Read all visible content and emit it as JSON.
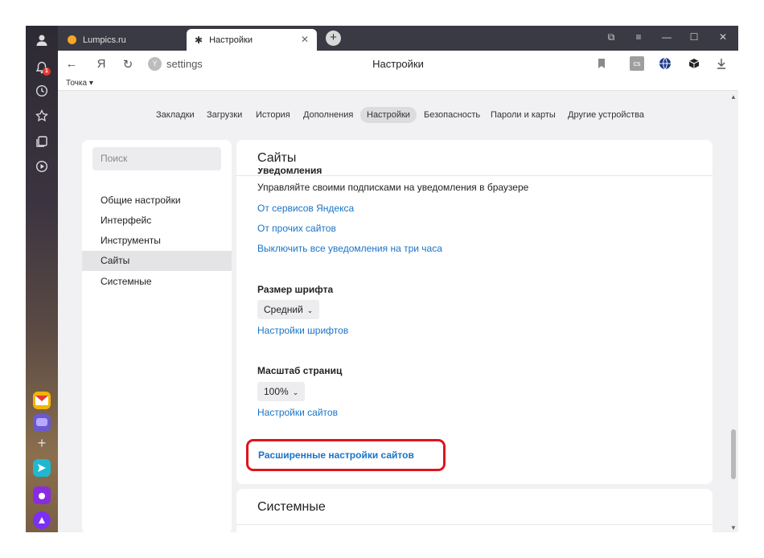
{
  "colors": {
    "accent_link": "#1a73c8",
    "highlight_box": "#e0141c",
    "tab_strip": "#3a3a44",
    "sidebar_dark": "#2d2a33"
  },
  "sidebar_icons": [
    "user-icon",
    "bell-icon",
    "history-icon",
    "star-icon",
    "collections-icon",
    "play-icon"
  ],
  "notification_badge": "1",
  "sidebar_apps": [
    "mail-app-icon",
    "messenger-app-icon",
    "add-icon",
    "send-app-icon",
    "music-app-icon",
    "alice-app-icon"
  ],
  "tabs": [
    {
      "label": "Lumpics.ru",
      "icon": "favicon-dot-icon"
    },
    {
      "label": "Настройки",
      "icon": "gear-icon",
      "close": "✕"
    }
  ],
  "window_controls": [
    "⧉",
    "≡",
    "—",
    "☐",
    "✕"
  ],
  "address_bar": {
    "back": "←",
    "yandex": "Я",
    "reload": "↻",
    "url": "settings",
    "page_title": "Настройки",
    "bookmarks_bar_item": "Точка ▾",
    "extension_lastpass": "cs"
  },
  "nav_tabs": [
    "Закладки",
    "Загрузки",
    "История",
    "Дополнения",
    "Настройки",
    "Безопасность",
    "Пароли и карты",
    "Другие устройства"
  ],
  "nav_active": "Настройки",
  "settings_sidebar": {
    "search_placeholder": "Поиск",
    "items": [
      "Общие настройки",
      "Интерфейс",
      "Инструменты",
      "Сайты",
      "Системные"
    ],
    "active": "Сайты"
  },
  "sites_card": {
    "title": "Сайты",
    "clipped_heading": "Уведомления",
    "notifications_desc": "Управляйте своими подписками на уведомления в браузере",
    "link_yandex": "От сервисов Яндекса",
    "link_other": "От прочих сайтов",
    "link_mute": "Выключить все уведомления на три часа",
    "font_size_label": "Размер шрифта",
    "font_size_value": "Средний",
    "font_settings_link": "Настройки шрифтов",
    "zoom_label": "Масштаб страниц",
    "zoom_value": "100%",
    "site_settings_link": "Настройки сайтов",
    "advanced_link": "Расширенные настройки сайтов"
  },
  "system_card": {
    "title": "Системные"
  }
}
